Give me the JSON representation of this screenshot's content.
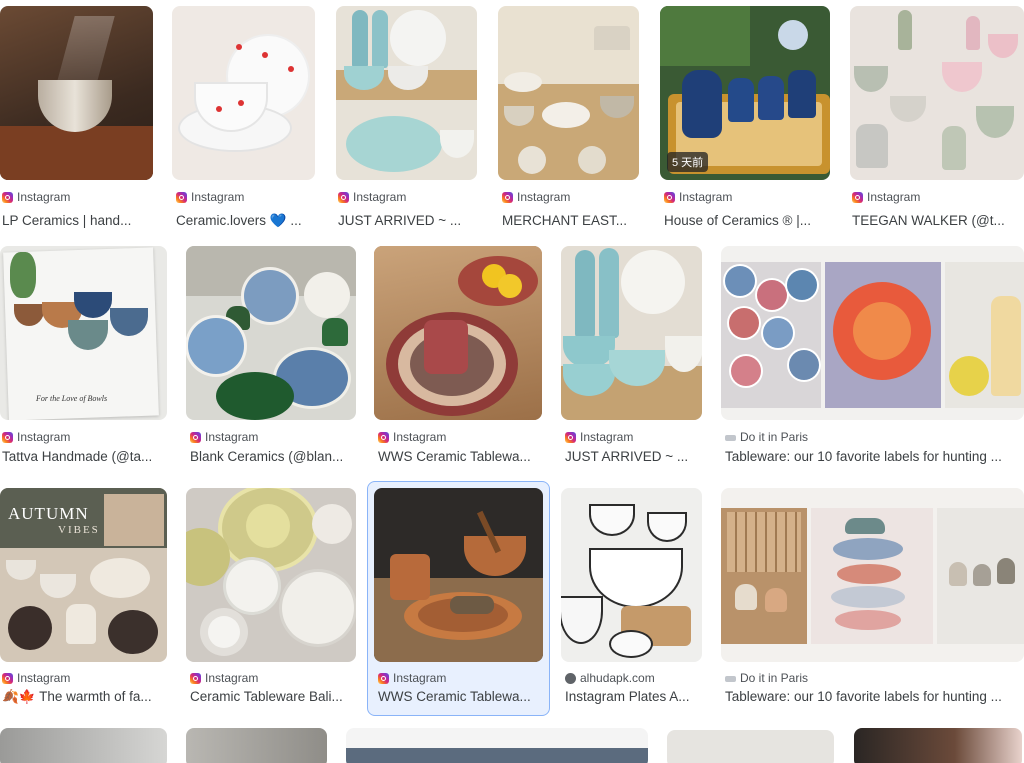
{
  "results": [
    {
      "source": "Instagram",
      "title": "LP Ceramics | hand..."
    },
    {
      "source": "Instagram",
      "title": "Ceramic.lovers 💙 ..."
    },
    {
      "source": "Instagram",
      "title": "JUST ARRIVED ~ ..."
    },
    {
      "source": "Instagram",
      "title": "MERCHANT EAST..."
    },
    {
      "source": "Instagram",
      "title": "House of Ceramics ® |...",
      "badge": "5 天前"
    },
    {
      "source": "Instagram",
      "title": "TEEGAN WALKER (@t..."
    },
    {
      "source": "Instagram",
      "title": "Tattva Handmade (@ta...",
      "image_text": "For the Love of Bowls"
    },
    {
      "source": "Instagram",
      "title": "Blank Ceramics (@blan..."
    },
    {
      "source": "Instagram",
      "title": "WWS Ceramic Tablewa..."
    },
    {
      "source": "Instagram",
      "title": "JUST ARRIVED ~ ..."
    },
    {
      "source": "Do it in Paris",
      "title": "Tableware: our 10 favorite labels for hunting ..."
    },
    {
      "source": "Instagram",
      "title": "🍂🍁 The warmth of fa...",
      "image_text_1": "AUTUMN",
      "image_text_2": "VIBES"
    },
    {
      "source": "Instagram",
      "title": "Ceramic Tableware Bali..."
    },
    {
      "source": "Instagram",
      "title": "WWS Ceramic Tablewa..."
    },
    {
      "source": "alhudapk.com",
      "title": "Instagram Plates A..."
    },
    {
      "source": "Do it in Paris",
      "title": "Tableware: our 10 favorite labels for hunting ..."
    }
  ],
  "colors": {
    "accent_selected_border": "#8ab4f8",
    "selected_bg": "#e8f0fe",
    "text": "#3c4043"
  }
}
